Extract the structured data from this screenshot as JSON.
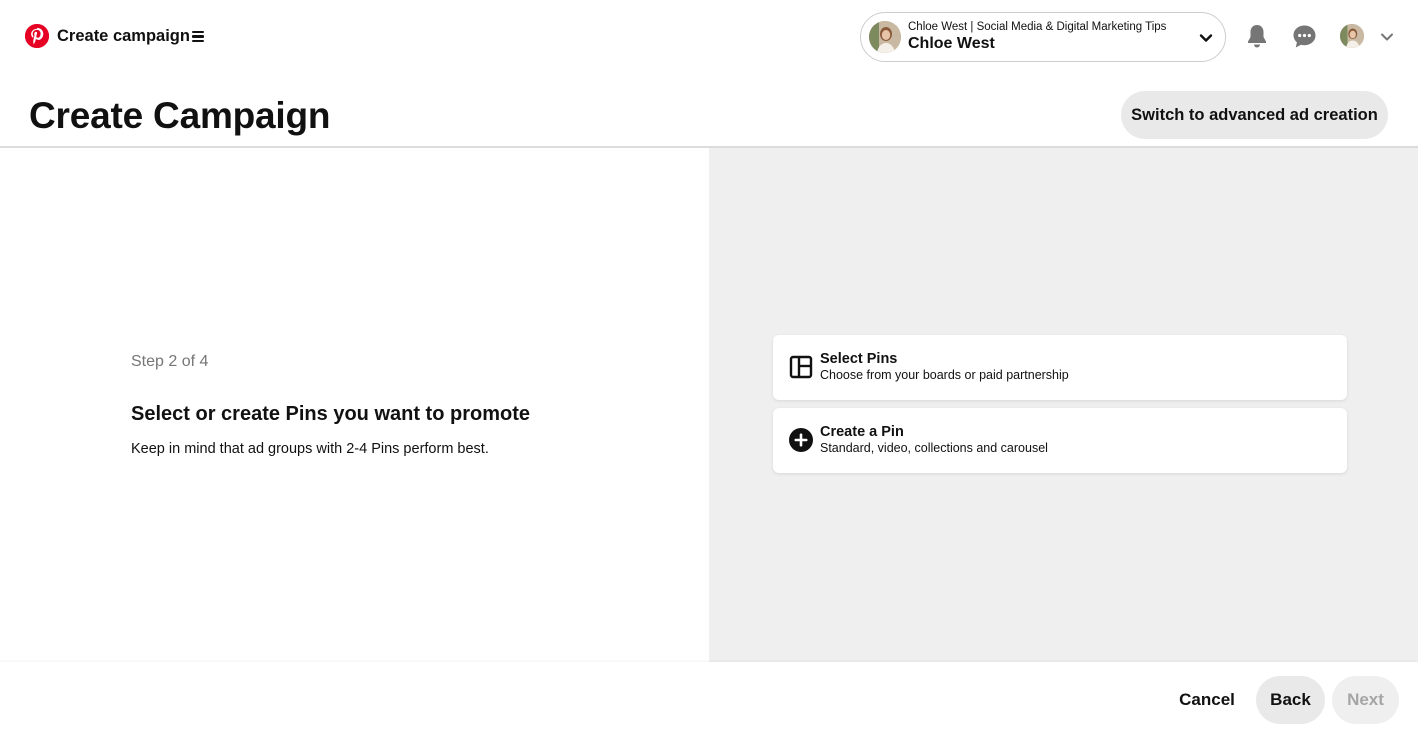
{
  "topbar": {
    "app_title": "Create campaign",
    "logo_icon": "pinterest-logo-icon",
    "brand_color": "#e60023",
    "account": {
      "subtitle": "Chloe West | Social Media & Digital Marketing Tips",
      "name": "Chloe West"
    }
  },
  "header": {
    "title": "Create Campaign",
    "switch_label": "Switch to advanced ad creation"
  },
  "step": {
    "counter": "Step 2 of 4",
    "heading": "Select or create Pins you want to promote",
    "description": "Keep in mind that ad groups with 2-4 Pins perform best."
  },
  "options": [
    {
      "title": "Select Pins",
      "subtitle": "Choose from your boards or paid partnership",
      "icon": "layout-grid-icon"
    },
    {
      "title": "Create a Pin",
      "subtitle": "Standard, video, collections and carousel",
      "icon": "plus-circle-icon"
    }
  ],
  "footer": {
    "cancel_label": "Cancel",
    "back_label": "Back",
    "next_label": "Next"
  }
}
